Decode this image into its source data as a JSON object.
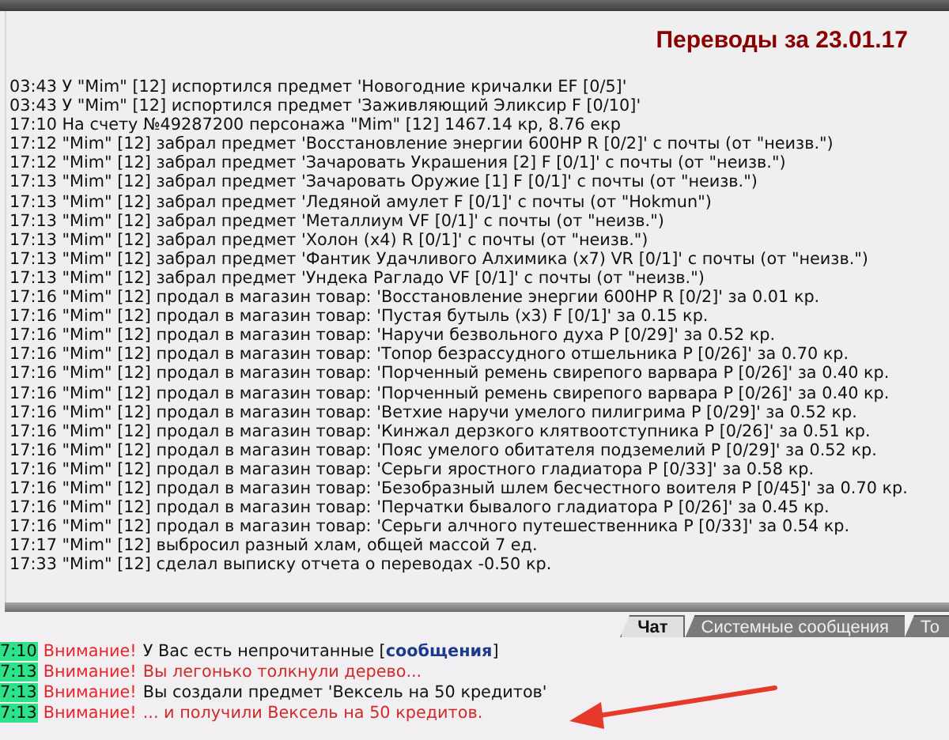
{
  "report": {
    "title": "Переводы за 23.01.17",
    "lines": [
      "03:43 У \"Mim\" [12] испортился предмет 'Новогодние кричалки EF [0/5]'",
      "03:43 У \"Mim\" [12] испортился предмет 'Заживляющий Эликсир F [0/10]'",
      "17:10 На счету №49287200 персонажа \"Mim\" [12] 1467.14 кр, 8.76 екр",
      "17:12 \"Mim\" [12] забрал предмет 'Восстановление энергии 600HP R [0/2]' с почты (от \"неизв.\")",
      "17:12 \"Mim\" [12] забрал предмет 'Зачаровать Украшения [2] F [0/1]' с почты (от \"неизв.\")",
      "17:13 \"Mim\" [12] забрал предмет 'Зачаровать Оружие [1] F [0/1]' с почты (от \"неизв.\")",
      "17:13 \"Mim\" [12] забрал предмет 'Ледяной амулет F [0/1]' с почты (от \"Hokmun\")",
      "17:13 \"Mim\" [12] забрал предмет 'Металлиум VF [0/1]' с почты (от \"неизв.\")",
      "17:13 \"Mim\" [12] забрал предмет 'Холон (x4) R [0/1]' с почты (от \"неизв.\")",
      "17:13 \"Mim\" [12] забрал предмет 'Фантик Удачливого Алхимика (x7) VR [0/1]' с почты (от \"неизв.\")",
      "17:13 \"Mim\" [12] забрал предмет 'Ундека Рагладо VF [0/1]' с почты (от \"неизв.\")",
      "17:16 \"Mim\" [12] продал в магазин товар: 'Восстановление энергии 600HP R [0/2]' за 0.01 кр.",
      "17:16 \"Mim\" [12] продал в магазин товар: 'Пустая бутыль (x3) F [0/1]' за 0.15 кр.",
      "17:16 \"Mim\" [12] продал в магазин товар: 'Наручи безвольного духа P [0/29]' за 0.52 кр.",
      "17:16 \"Mim\" [12] продал в магазин товар: 'Топор безрассудного отшельника P [0/26]' за 0.70 кр.",
      "17:16 \"Mim\" [12] продал в магазин товар: 'Порченный ремень свирепого варвара P [0/26]' за 0.40 кр.",
      "17:16 \"Mim\" [12] продал в магазин товар: 'Порченный ремень свирепого варвара P [0/26]' за 0.40 кр.",
      "17:16 \"Mim\" [12] продал в магазин товар: 'Ветхие наручи умелого пилигрима P [0/29]' за 0.52 кр.",
      "17:16 \"Mim\" [12] продал в магазин товар: 'Кинжал дерзкого клятвоотступника P [0/26]' за 0.51 кр.",
      "17:16 \"Mim\" [12] продал в магазин товар: 'Пояс умелого обитателя подземелий P [0/29]' за 0.52 кр.",
      "17:16 \"Mim\" [12] продал в магазин товар: 'Серьги яростного гладиатора P [0/33]' за 0.58 кр.",
      "17:16 \"Mim\" [12] продал в магазин товар: 'Безобразный шлем бесчестного воителя P [0/45]' за 0.70 кр.",
      "17:16 \"Mim\" [12] продал в магазин товар: 'Перчатки бывалого гладиатора P [0/26]' за 0.45 кр.",
      "17:16 \"Mim\" [12] продал в магазин товар: 'Серьги алчного путешественника P [0/33]' за 0.54 кр.",
      "17:17 \"Mim\" [12] выбросил разный хлам, общей массой 7 ед.",
      "17:33 \"Mim\" [12] сделал выписку отчета о переводах -0.50 кр."
    ]
  },
  "tabs": [
    {
      "label": "Чат",
      "selected": true
    },
    {
      "label": "Системные сообщения",
      "selected": false
    },
    {
      "label": "То",
      "selected": false
    }
  ],
  "chat": [
    {
      "time": "7:10",
      "label": "Внимание!",
      "kind": "plain",
      "text": "У Вас есть непрочитанные [",
      "link": "сообщения",
      "text_after": "]"
    },
    {
      "time": "7:13",
      "label": "Внимание!",
      "kind": "alert",
      "text": "Вы легонько толкнули дерево..."
    },
    {
      "time": "7:13",
      "label": "Внимание!",
      "kind": "plain",
      "text": "Вы создали предмет 'Вексель на 50 кредитов'"
    },
    {
      "time": "7:13",
      "label": "Внимание!",
      "kind": "alert",
      "text": "... и получили Вексель на 50 кредитов."
    }
  ]
}
